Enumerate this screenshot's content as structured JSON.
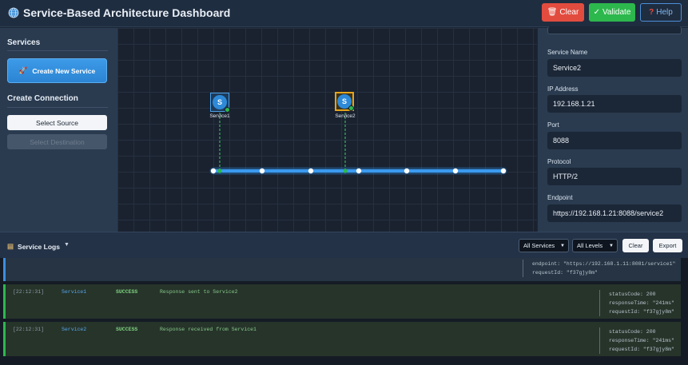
{
  "header": {
    "title": "Service-Based Architecture Dashboard",
    "clear_label": "Clear",
    "validate_label": "Validate",
    "help_label": "Help"
  },
  "sidebar": {
    "services_heading": "Services",
    "create_service_label": "Create New Service",
    "connection_heading": "Create Connection",
    "select_source_label": "Select Source",
    "select_destination_label": "Select Destination"
  },
  "canvas": {
    "services": [
      {
        "icon_letter": "S",
        "label": "Service1",
        "selected": false
      },
      {
        "icon_letter": "S",
        "label": "Service2",
        "selected": true
      }
    ]
  },
  "details": {
    "service_name_label": "Service Name",
    "service_name_value": "Service2",
    "ip_label": "IP Address",
    "ip_value": "192.168.1.21",
    "port_label": "Port",
    "port_value": "8088",
    "protocol_label": "Protocol",
    "protocol_value": "HTTP/2",
    "endpoint_label": "Endpoint",
    "endpoint_value": "https://192.168.1.21:8088/service2"
  },
  "logs": {
    "title": "Service Logs",
    "service_filter": "All Services",
    "level_filter": "All Levels",
    "clear_label": "Clear",
    "export_label": "Export",
    "entries": [
      {
        "details": [
          "endpoint: \"https://192.168.1.11:8081/service1\"",
          "requestId: \"f37gjy8m\""
        ]
      },
      {
        "time": "[22:12:31]",
        "service": "Service1",
        "level": "SUCCESS",
        "message": "Response sent to Service2",
        "details": [
          "statusCode: 200",
          "responseTime: \"241ms\"",
          "requestId: \"f37gjy8m\""
        ]
      },
      {
        "time": "[22:12:31]",
        "service": "Service2",
        "level": "SUCCESS",
        "message": "Response received from Service1",
        "details": [
          "statusCode: 200",
          "responseTime: \"241ms\"",
          "requestId: \"f37gjy8m\""
        ]
      }
    ]
  },
  "colors": {
    "accent": "#3b8ee0",
    "success": "#2db84d",
    "danger": "#e24c3f",
    "selected_border": "#e4a41b"
  }
}
